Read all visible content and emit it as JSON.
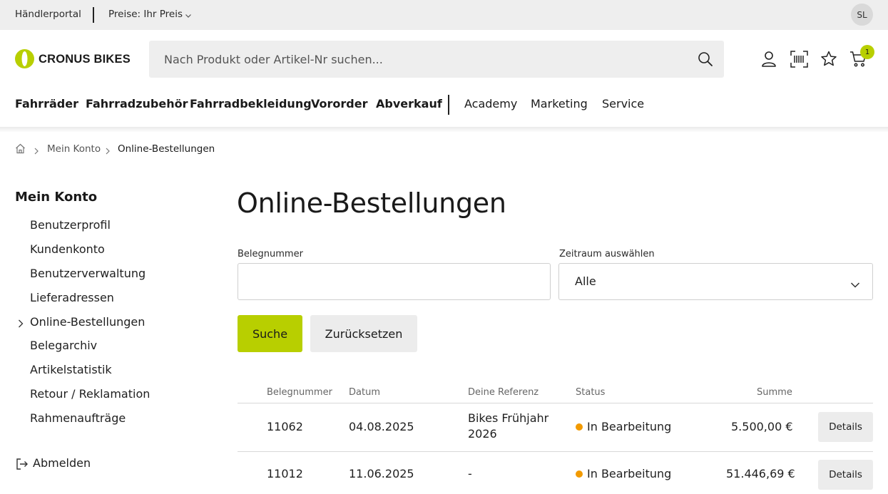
{
  "topbar": {
    "portal_label": "Händlerportal",
    "price_label": "Preise: Ihr Preis",
    "avatar_initials": "SL"
  },
  "header": {
    "brand": "CRONUS BIKES",
    "brand_color": "#b8cf00",
    "search_placeholder": "Nach Produkt oder Artikel-Nr suchen...",
    "cart_count": "1",
    "icons": [
      "search-icon",
      "user-icon",
      "barcode-scanner-icon",
      "star-icon",
      "cart-icon"
    ]
  },
  "nav": {
    "primary": [
      "Fahrräder",
      "Fahrradzubehör",
      "Fahrradbekleidung",
      "Vororder",
      "Abverkauf"
    ],
    "secondary": [
      "Academy",
      "Marketing",
      "Service"
    ]
  },
  "breadcrumb": {
    "items": [
      "Mein Konto",
      "Online-Bestellungen"
    ]
  },
  "sidebar": {
    "title": "Mein Konto",
    "items": [
      {
        "label": "Benutzerprofil"
      },
      {
        "label": "Kundenkonto"
      },
      {
        "label": "Benutzerverwaltung"
      },
      {
        "label": "Lieferadressen"
      },
      {
        "label": "Online-Bestellungen",
        "active": true
      },
      {
        "label": "Belegarchiv"
      },
      {
        "label": "Artikelstatistik"
      },
      {
        "label": "Retour / Reklamation"
      },
      {
        "label": "Rahmenaufträge"
      }
    ],
    "logout_label": "Abmelden"
  },
  "main": {
    "title": "Online-Bestellungen",
    "filters": {
      "document_number_label": "Belegnummer",
      "document_number_value": "",
      "period_label": "Zeitraum auswählen",
      "period_value": "Alle"
    },
    "search_button": "Suche",
    "reset_button": "Zurücksetzen",
    "table": {
      "headers": [
        "Belegnummer",
        "Datum",
        "Deine Referenz",
        "Status",
        "Summe"
      ],
      "rows": [
        {
          "number": "11062",
          "date": "04.08.2025",
          "reference": "Bikes Frühjahr 2026",
          "status": "In Bearbeitung",
          "total": "5.500,00 €",
          "action": "Details"
        },
        {
          "number": "11012",
          "date": "11.06.2025",
          "reference": "-",
          "status": "In Bearbeitung",
          "total": "51.446,69 €",
          "action": "Details"
        }
      ],
      "status_color": "#f29a00"
    }
  }
}
